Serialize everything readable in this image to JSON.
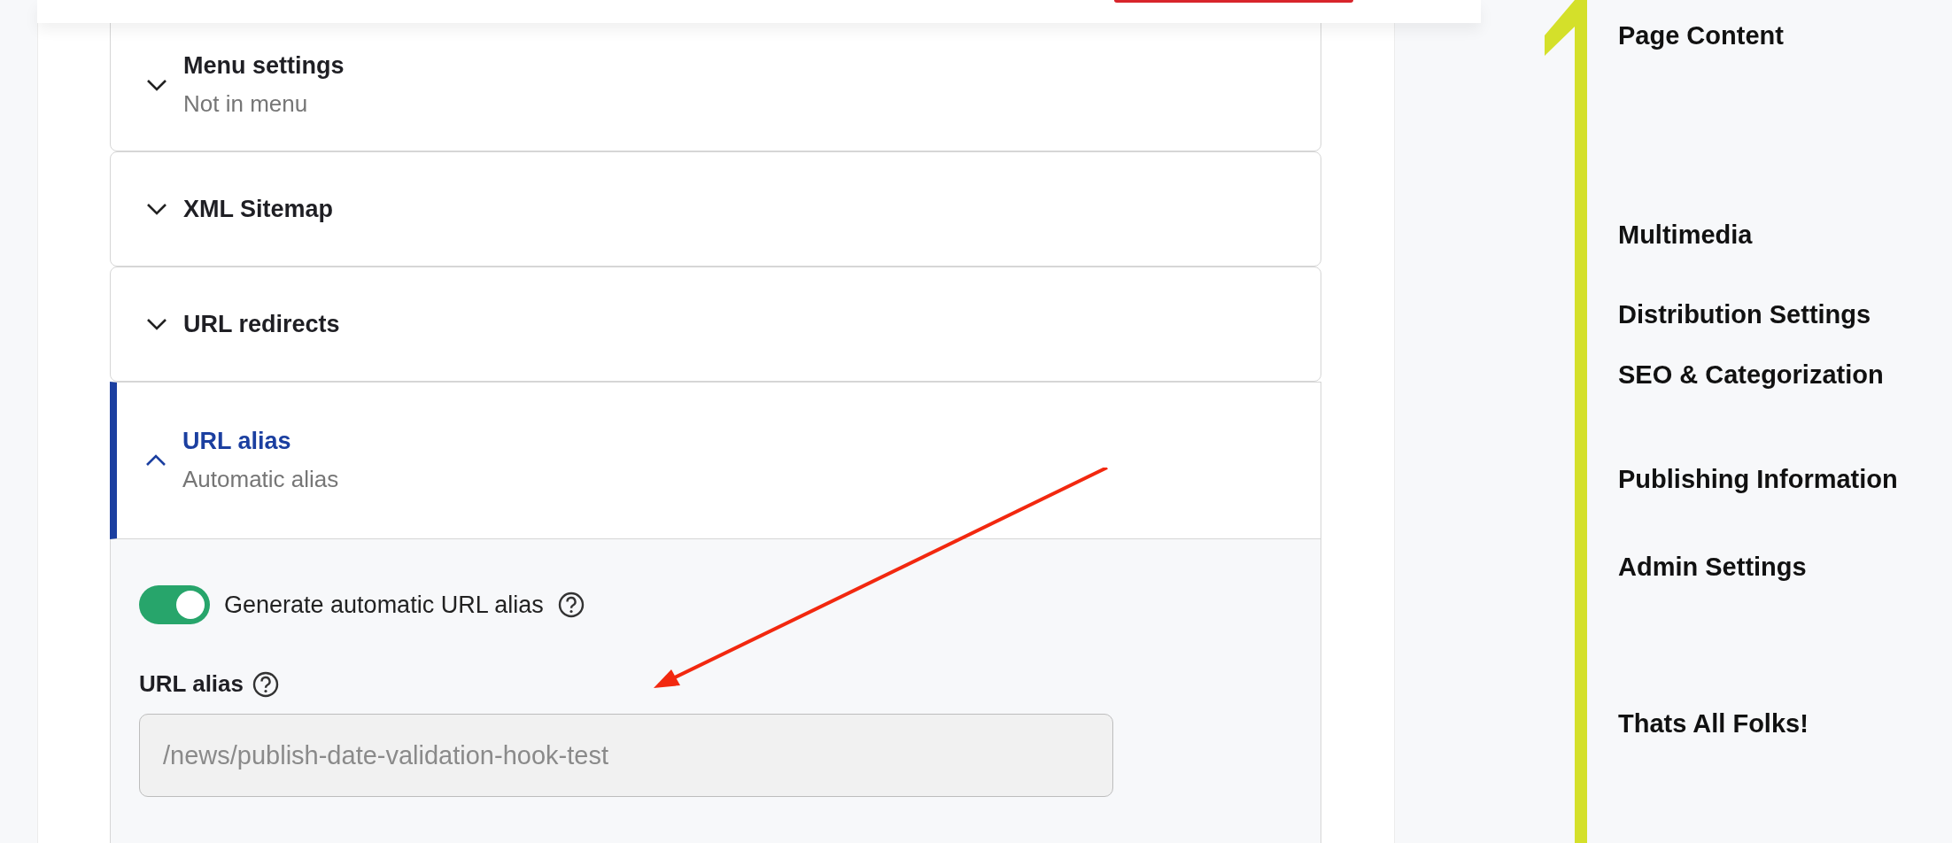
{
  "accordion": {
    "items": [
      {
        "title": "Menu settings",
        "summary": "Not in menu",
        "expanded": false
      },
      {
        "title": "XML Sitemap",
        "expanded": false
      },
      {
        "title": "URL redirects",
        "expanded": false
      },
      {
        "title": "URL alias",
        "summary": "Automatic alias",
        "expanded": true,
        "content": {
          "toggle": {
            "label": "Generate automatic URL alias",
            "on": true
          },
          "field": {
            "label": "URL alias",
            "value": "/news/publish-date-validation-hook-test",
            "disabled": true
          }
        }
      }
    ]
  },
  "nav": {
    "items": [
      {
        "label": "Page Content"
      },
      {
        "label": "Multimedia"
      },
      {
        "label": "Distribution Settings"
      },
      {
        "label": "SEO & Categorization"
      },
      {
        "label": "Publishing Information"
      },
      {
        "label": "Admin Settings"
      },
      {
        "label": "Thats All Folks!"
      }
    ]
  }
}
